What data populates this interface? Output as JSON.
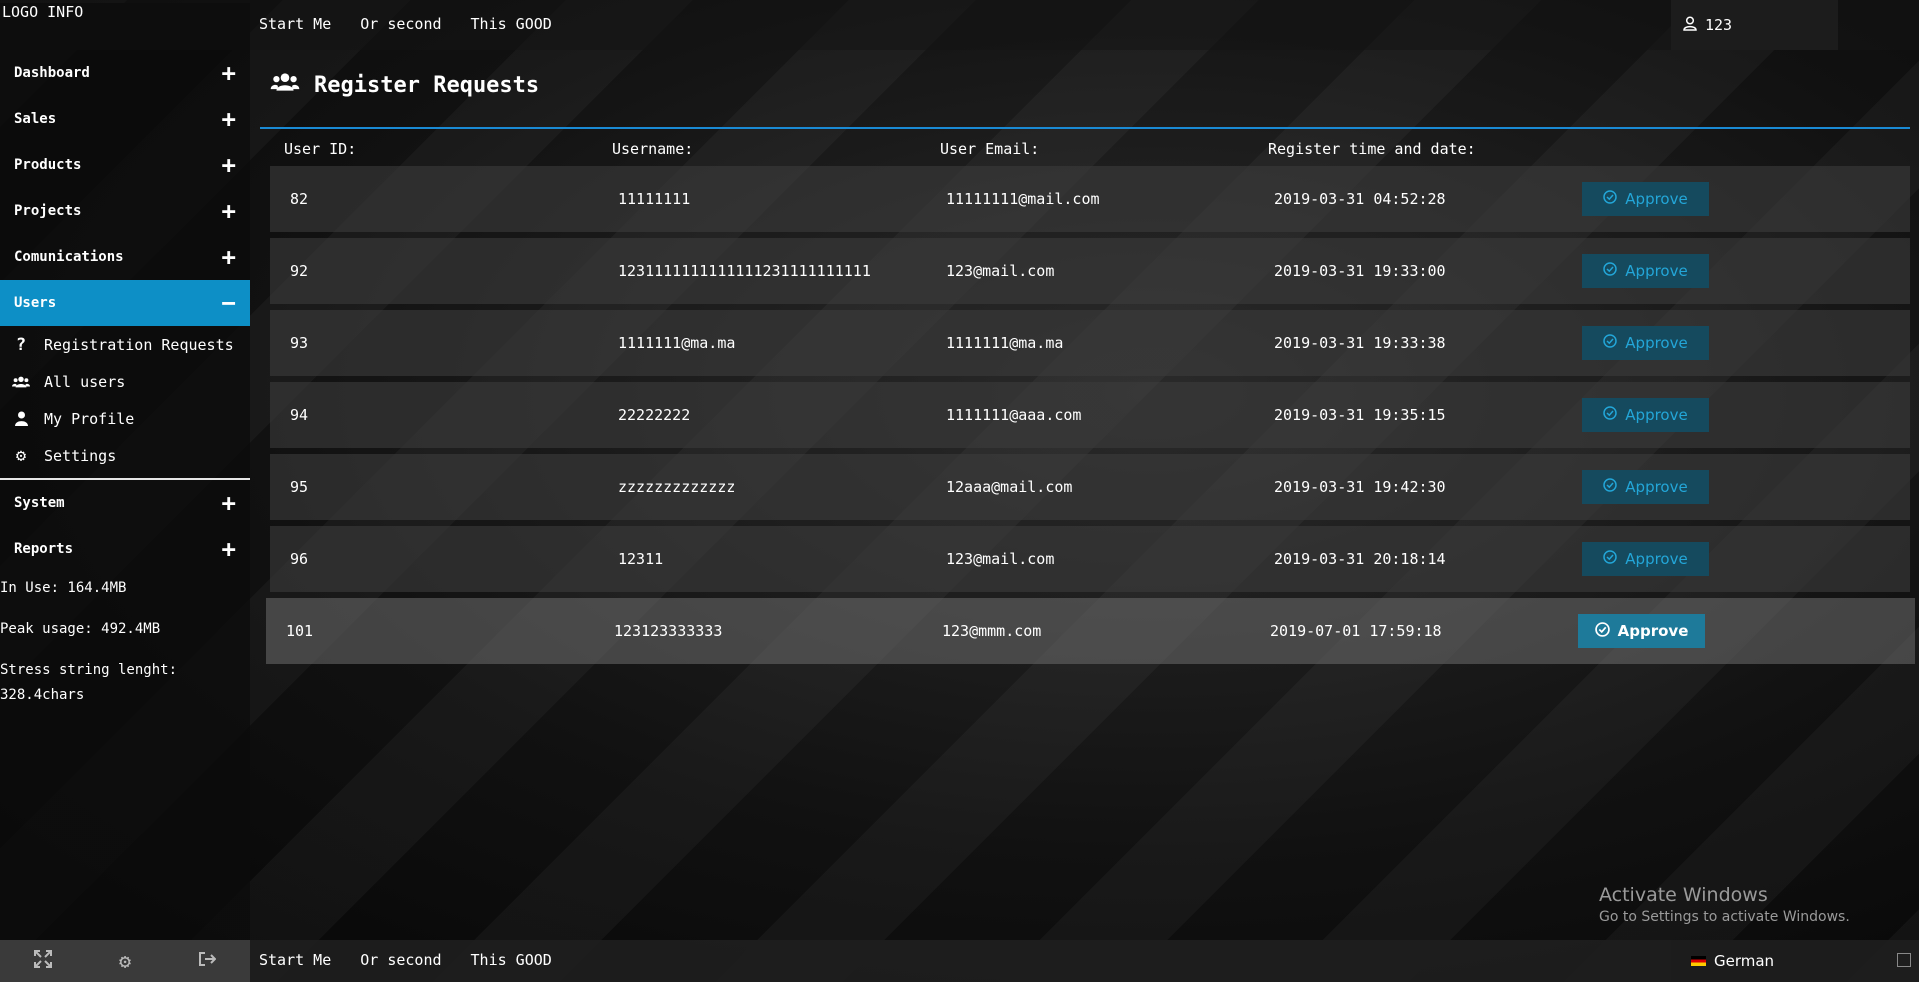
{
  "top": {
    "logo": "LOGO INFO",
    "nav": [
      "Start Me",
      "Or second",
      "This GOOD"
    ],
    "user": "123"
  },
  "sidebar": {
    "items": [
      {
        "label": "Dashboard",
        "toggle": "+"
      },
      {
        "label": "Sales",
        "toggle": "+"
      },
      {
        "label": "Products",
        "toggle": "+"
      },
      {
        "label": "Projects",
        "toggle": "+"
      },
      {
        "label": "Comunications",
        "toggle": "+"
      },
      {
        "label": "Users",
        "toggle": "−"
      },
      {
        "label": "System",
        "toggle": "+"
      },
      {
        "label": "Reports",
        "toggle": "+"
      }
    ],
    "users_submenu": [
      "Registration Requests",
      "All users",
      "My Profile",
      "Settings"
    ],
    "stats": {
      "in_use": "In Use: 164.4MB",
      "peak": "Peak usage: 492.4MB",
      "stress": "Stress string lenght: 328.4chars"
    }
  },
  "main": {
    "title": "Register Requests",
    "columns": [
      "User ID:",
      "Username:",
      "User Email:",
      "Register time and date:"
    ],
    "approve_label": "Approve",
    "rows": [
      {
        "id": "82",
        "username": "11111111",
        "email": "11111111@mail.com",
        "date": "2019-03-31 04:52:28"
      },
      {
        "id": "92",
        "username": "1231111111111111231111111111",
        "email": "123@mail.com",
        "date": "2019-03-31 19:33:00"
      },
      {
        "id": "93",
        "username": "1111111@ma.ma",
        "email": "1111111@ma.ma",
        "date": "2019-03-31 19:33:38"
      },
      {
        "id": "94",
        "username": "22222222",
        "email": "1111111@aaa.com",
        "date": "2019-03-31 19:35:15"
      },
      {
        "id": "95",
        "username": "zzzzzzzzzzzzz",
        "email": "12aaa@mail.com",
        "date": "2019-03-31 19:42:30"
      },
      {
        "id": "96",
        "username": "12311",
        "email": "123@mail.com",
        "date": "2019-03-31 20:18:14"
      },
      {
        "id": "101",
        "username": "123123333333",
        "email": "123@mmm.com",
        "date": "2019-07-01 17:59:18"
      }
    ]
  },
  "watermark": {
    "line1": "Activate Windows",
    "line2": "Go to Settings to activate Windows."
  },
  "bottom": {
    "nav": [
      "Start Me",
      "Or second",
      "This GOOD"
    ],
    "language": "German"
  },
  "colors": {
    "accent": "#0d8fc6",
    "approve_bg": "#154a5e",
    "approve_text": "#23a6d8"
  }
}
